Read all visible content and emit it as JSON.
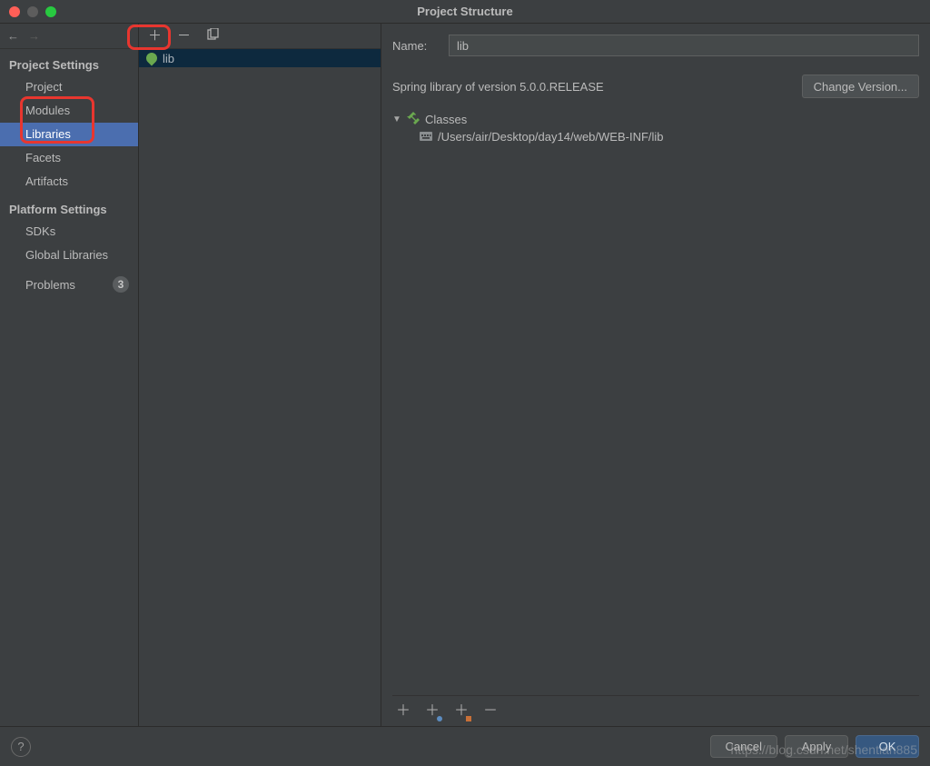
{
  "title": "Project Structure",
  "nav": {
    "back_enable": true,
    "fwd_enable": false
  },
  "sidebar": {
    "section_project": "Project Settings",
    "items_project": [
      "Project",
      "Modules",
      "Libraries",
      "Facets",
      "Artifacts"
    ],
    "selected_project_index": 2,
    "section_platform": "Platform Settings",
    "items_platform": [
      "SDKs",
      "Global Libraries"
    ],
    "problems_label": "Problems",
    "problems_count": "3"
  },
  "mid": {
    "library_item": "lib"
  },
  "form": {
    "name_label": "Name:",
    "name_value": "lib"
  },
  "info": {
    "description": "Spring library of version 5.0.0.RELEASE",
    "change_btn": "Change Version..."
  },
  "tree": {
    "classes_label": "Classes",
    "path": "/Users/air/Desktop/day14/web/WEB-INF/lib"
  },
  "footer": {
    "cancel": "Cancel",
    "apply": "Apply",
    "ok": "OK"
  },
  "watermark": "https://blog.csdn.net/shentian885"
}
